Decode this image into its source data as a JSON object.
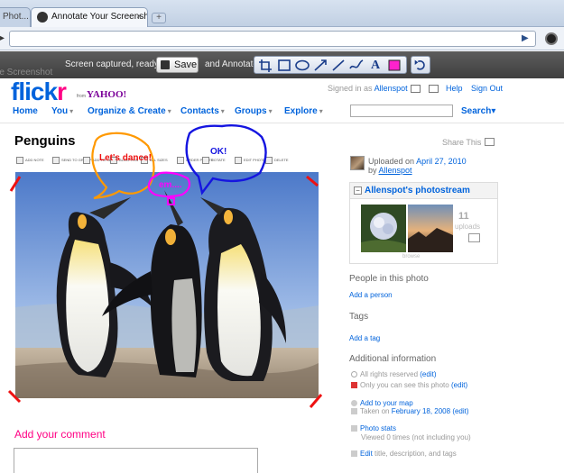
{
  "browser": {
    "inactive_tab": "Phot...",
    "active_tab": "Annotate Your Screenshot",
    "close_glyph": "×",
    "newtab_glyph": "+"
  },
  "annotator": {
    "ghost_text": "re Screenshot",
    "captured_text": "Screen captured, ready to",
    "save_label": "Save",
    "and_annotate": "and Annotate",
    "tools": [
      "crop-icon",
      "rectangle-icon",
      "ellipse-icon",
      "arrow-icon",
      "line-icon",
      "freehand-icon",
      "text-icon",
      "highlight-icon",
      "undo-icon"
    ],
    "text_tool_glyph": "A"
  },
  "flickr": {
    "logo_a": "flick",
    "logo_b": "r",
    "from": "from",
    "yahoo": "YAHOO!",
    "signed_in_as": "Signed in as",
    "username": "Allenspot",
    "help": "Help",
    "sign_out": "Sign Out",
    "nav": {
      "home": "Home",
      "you": "You",
      "organize": "Organize & Create",
      "contacts": "Contacts",
      "groups": "Groups",
      "explore": "Explore",
      "search": "Search"
    }
  },
  "photo_page": {
    "title": "Penguins",
    "share": "Share This",
    "actions": [
      {
        "name": "add-note",
        "label": "ADD NOTE"
      },
      {
        "name": "send-to-group",
        "label": "SEND TO GROUP"
      },
      {
        "name": "add-to-set",
        "label": "ADD TO SET"
      },
      {
        "name": "blog-this",
        "label": "BLOG THIS"
      },
      {
        "name": "all-sizes",
        "label": "ALL SIZES"
      },
      {
        "name": "order-prints",
        "label": "ORDER PRINTS"
      },
      {
        "name": "rotate",
        "label": "ROTATE"
      },
      {
        "name": "edit-photo",
        "label": "EDIT PHOTO"
      },
      {
        "name": "delete",
        "label": "DELETE"
      }
    ],
    "annotations": {
      "bubble1": "Let's dance!",
      "bubble2": "em....",
      "bubble3": "OK!"
    },
    "comment_heading": "Add your comment"
  },
  "sidebar": {
    "uploaded_on": "Uploaded on",
    "upload_date": "April 27, 2010",
    "by": "by",
    "owner": "Allenspot",
    "stream_title": "Allenspot's photostream",
    "stream_minus": "−",
    "uploads_count": "11",
    "uploads_label": "uploads",
    "browse": "browse",
    "people_heading": "People in this photo",
    "add_person": "Add a person",
    "tags_heading": "Tags",
    "add_tag": "Add a tag",
    "additional_heading": "Additional information",
    "rights": "All rights reserved",
    "rights_edit": "(edit)",
    "visibility": "Only you can see this photo",
    "visibility_edit": "(edit)",
    "add_to_map": "Add to your map",
    "taken_on": "Taken on",
    "taken_date": "February 18, 2008",
    "taken_edit": "(edit)",
    "photo_stats": "Photo stats",
    "viewed": "Viewed 0 times",
    "viewed_note": "(not including you)",
    "edit": "Edit",
    "edit_rest": "title, description, and tags"
  },
  "colors": {
    "flickr_blue": "#0063dc",
    "flickr_pink": "#ff0084",
    "annot_orange": "#ff9900",
    "annot_magenta": "#ff00ff",
    "annot_blue": "#1515e0",
    "annot_red": "#ee1111"
  }
}
